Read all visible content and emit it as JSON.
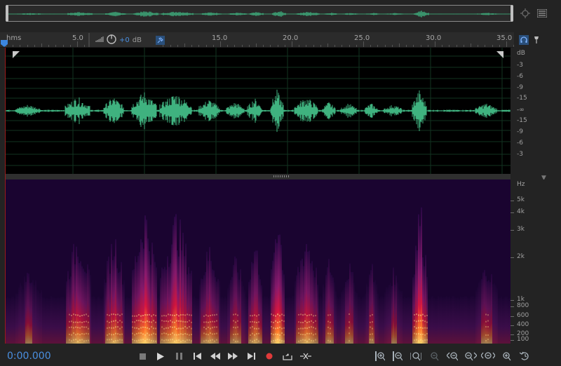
{
  "colors": {
    "waveform": "#3fb27f",
    "accent": "#4a8fe0",
    "record": "#e03a3a",
    "background": "#232323"
  },
  "ruler": {
    "unit_label": "hms",
    "ticks": [
      "5.0",
      "15.0",
      "20.0",
      "25.0",
      "30.0",
      "35.0"
    ],
    "hud": {
      "gain": "+0",
      "unit": "dB"
    }
  },
  "amplitude_scale": {
    "unit": "dB",
    "labels": [
      "-3",
      "-6",
      "-9",
      "-15",
      "-∞",
      "-15",
      "-9",
      "-6",
      "-3"
    ]
  },
  "frequency_scale": {
    "unit": "Hz",
    "labels": [
      "5k",
      "4k",
      "3k",
      "2k",
      "1k",
      "800",
      "600",
      "400",
      "200",
      "100"
    ]
  },
  "transport": {
    "time": "0:00.000",
    "buttons": [
      "stop",
      "play",
      "pause",
      "move-to-start",
      "rewind",
      "fast-forward",
      "move-to-end",
      "record",
      "skip-selection",
      "loop"
    ]
  },
  "icons": {
    "overview_zoom": "zoom-target-icon",
    "overview_menu": "hamburger-icon",
    "ruler_headphones": "headphones-icon",
    "ruler_marker": "marker-pin-icon",
    "ruler_pin": "pin-icon",
    "hud_meter": "level-meter-icon",
    "hud_knob": "volume-knob-icon"
  }
}
